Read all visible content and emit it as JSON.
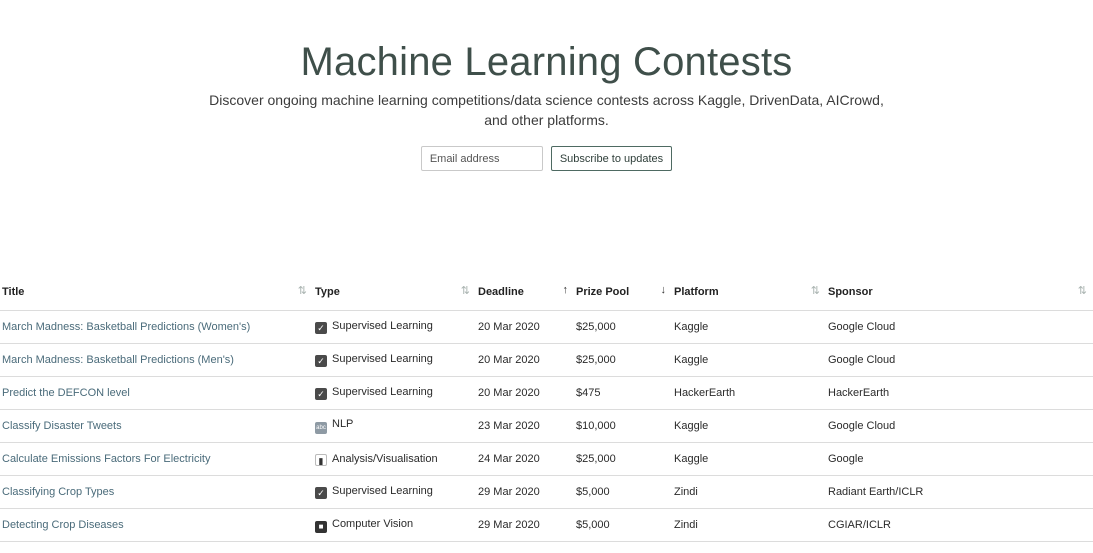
{
  "hero": {
    "title": "Machine Learning Contests",
    "subtitle": "Discover ongoing machine learning competitions/data science contests across Kaggle, DrivenData, AICrowd, and other platforms.",
    "email_placeholder": "Email address",
    "subscribe_label": "Subscribe to updates"
  },
  "table": {
    "headers": {
      "title": "Title",
      "type": "Type",
      "deadline": "Deadline",
      "prize": "Prize Pool",
      "platform": "Platform",
      "sponsor": "Sponsor"
    },
    "sort_icons": {
      "neutral": "⇅",
      "asc": "↑",
      "desc": "↓"
    },
    "rows": [
      {
        "title": "March Madness: Basketball Predictions (Women's)",
        "type_icon": "check-icon",
        "type": "Supervised Learning",
        "deadline": "20 Mar 2020",
        "prize": "$25,000",
        "platform": "Kaggle",
        "sponsor": "Google Cloud"
      },
      {
        "title": "March Madness: Basketball Predictions (Men's)",
        "type_icon": "check-icon",
        "type": "Supervised Learning",
        "deadline": "20 Mar 2020",
        "prize": "$25,000",
        "platform": "Kaggle",
        "sponsor": "Google Cloud"
      },
      {
        "title": "Predict the DEFCON level",
        "type_icon": "check-icon",
        "type": "Supervised Learning",
        "deadline": "20 Mar 2020",
        "prize": "$475",
        "platform": "HackerEarth",
        "sponsor": "HackerEarth"
      },
      {
        "title": "Classify Disaster Tweets",
        "type_icon": "nlp-icon",
        "type": "NLP",
        "deadline": "23 Mar 2020",
        "prize": "$10,000",
        "platform": "Kaggle",
        "sponsor": "Google Cloud"
      },
      {
        "title": "Calculate Emissions Factors For Electricity",
        "type_icon": "chart-icon",
        "type": "Analysis/Visualisation",
        "deadline": "24 Mar 2020",
        "prize": "$25,000",
        "platform": "Kaggle",
        "sponsor": "Google"
      },
      {
        "title": "Classifying Crop Types",
        "type_icon": "check-icon",
        "type": "Supervised Learning",
        "deadline": "29 Mar 2020",
        "prize": "$5,000",
        "platform": "Zindi",
        "sponsor": "Radiant Earth/ICLR"
      },
      {
        "title": "Detecting Crop Diseases",
        "type_icon": "camera-icon",
        "type": "Computer Vision",
        "deadline": "29 Mar 2020",
        "prize": "$5,000",
        "platform": "Zindi",
        "sponsor": "CGIAR/ICLR"
      },
      {
        "title": "",
        "type_icon": "",
        "type": "",
        "deadline": "",
        "prize": "",
        "platform": "",
        "sponsor": ""
      }
    ]
  }
}
